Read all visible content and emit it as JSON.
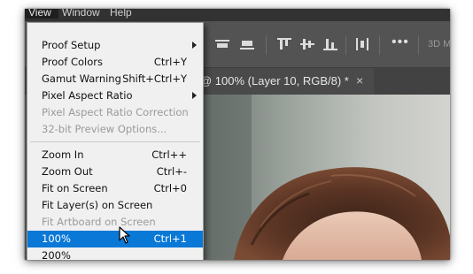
{
  "menubar": {
    "items": [
      "View",
      "Window",
      "Help"
    ]
  },
  "toolbar": {
    "icons": [
      "align-horizontal-icon",
      "align-top-icon",
      "align-vertical-center-icon",
      "align-bottom-icon",
      "distribute-icon"
    ],
    "more_label": "•••",
    "mode_label": "3D M"
  },
  "document_tab": {
    "title": "@ 100% (Layer 10, RGB/8) *",
    "close_label": "×"
  },
  "view_menu": {
    "items": [
      {
        "label": "Proof Setup",
        "shortcut": "",
        "submenu": true,
        "disabled": false
      },
      {
        "label": "Proof Colors",
        "shortcut": "Ctrl+Y",
        "submenu": false,
        "disabled": false
      },
      {
        "label": "Gamut Warning",
        "shortcut": "Shift+Ctrl+Y",
        "submenu": false,
        "disabled": false
      },
      {
        "label": "Pixel Aspect Ratio",
        "shortcut": "",
        "submenu": true,
        "disabled": false
      },
      {
        "label": "Pixel Aspect Ratio Correction",
        "shortcut": "",
        "submenu": false,
        "disabled": true
      },
      {
        "label": "32-bit Preview Options...",
        "shortcut": "",
        "submenu": false,
        "disabled": true
      },
      {
        "label": "Zoom In",
        "shortcut": "Ctrl++",
        "submenu": false,
        "disabled": false
      },
      {
        "label": "Zoom Out",
        "shortcut": "Ctrl+-",
        "submenu": false,
        "disabled": false
      },
      {
        "label": "Fit on Screen",
        "shortcut": "Ctrl+0",
        "submenu": false,
        "disabled": false
      },
      {
        "label": "Fit Layer(s) on Screen",
        "shortcut": "",
        "submenu": false,
        "disabled": false
      },
      {
        "label": "Fit Artboard on Screen",
        "shortcut": "",
        "submenu": false,
        "disabled": true
      },
      {
        "label": "100%",
        "shortcut": "Ctrl+1",
        "submenu": false,
        "disabled": false,
        "selected": true
      },
      {
        "label": "200%",
        "shortcut": "",
        "submenu": false,
        "disabled": false
      }
    ]
  },
  "colors": {
    "menu_highlight": "#0a78d7",
    "menu_background": "#f0f0f0",
    "app_background": "#535353",
    "menubar_background": "#323232"
  }
}
